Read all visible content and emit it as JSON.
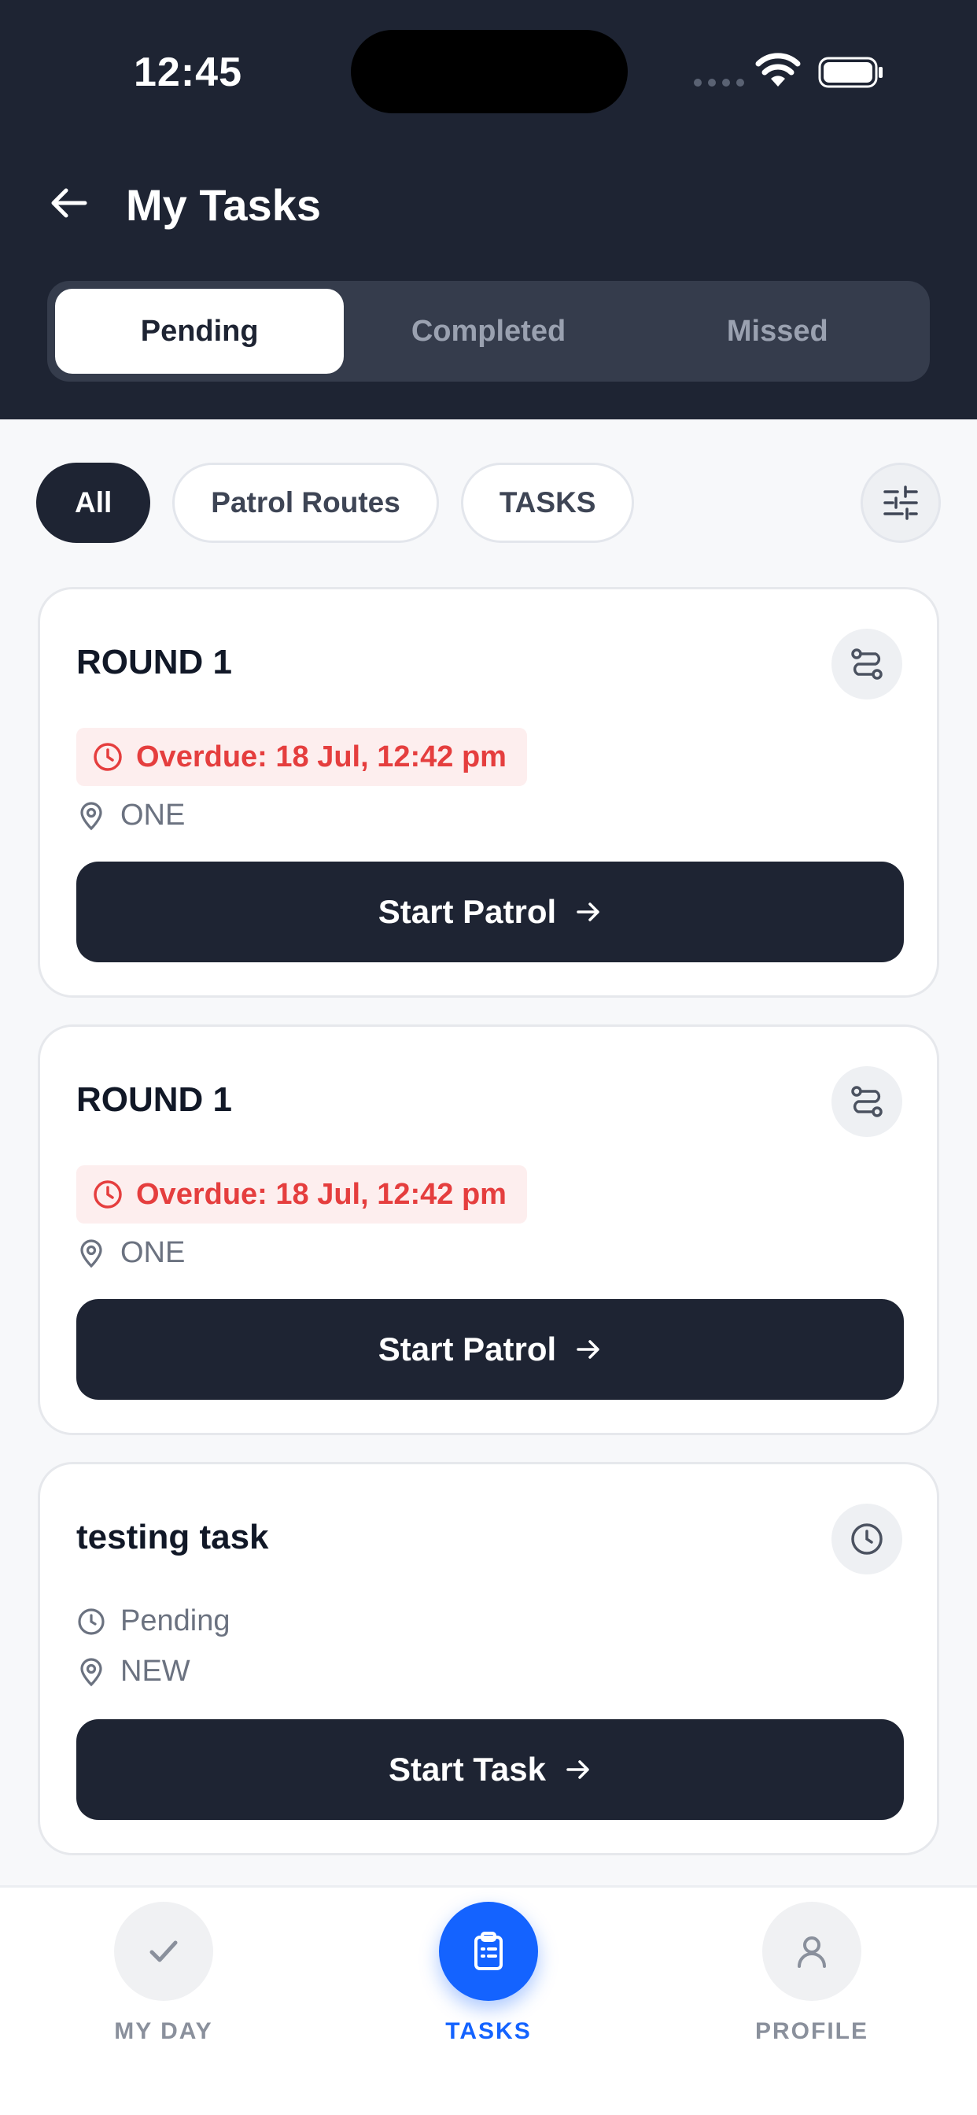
{
  "status_bar": {
    "time": "12:45"
  },
  "header": {
    "title": "My Tasks",
    "tabs": [
      {
        "label": "Pending",
        "active": true
      },
      {
        "label": "Completed",
        "active": false
      },
      {
        "label": "Missed",
        "active": false
      }
    ]
  },
  "filters": {
    "chips": [
      {
        "label": "All",
        "active": true
      },
      {
        "label": "Patrol Routes",
        "active": false
      },
      {
        "label": "TASKS",
        "active": false
      }
    ],
    "filter_icon": "sliders-icon"
  },
  "cards": [
    {
      "title": "ROUND 1",
      "type_icon": "route-icon",
      "overdue": "Overdue: 18 Jul, 12:42 pm",
      "location": "ONE",
      "action": "Start Patrol"
    },
    {
      "title": "ROUND 1",
      "type_icon": "route-icon",
      "overdue": "Overdue: 18 Jul, 12:42 pm",
      "location": "ONE",
      "action": "Start Patrol"
    },
    {
      "title": "testing task",
      "type_icon": "clock-icon",
      "status": "Pending",
      "location": "NEW",
      "action": "Start Task"
    }
  ],
  "bottom_nav": [
    {
      "label": "MY DAY",
      "icon": "check-icon",
      "active": false
    },
    {
      "label": "TASKS",
      "icon": "clipboard-icon",
      "active": true
    },
    {
      "label": "PROFILE",
      "icon": "user-icon",
      "active": false
    }
  ],
  "colors": {
    "header_bg": "#1e2433",
    "accent": "#1463ff",
    "overdue": "#e53e3e"
  }
}
